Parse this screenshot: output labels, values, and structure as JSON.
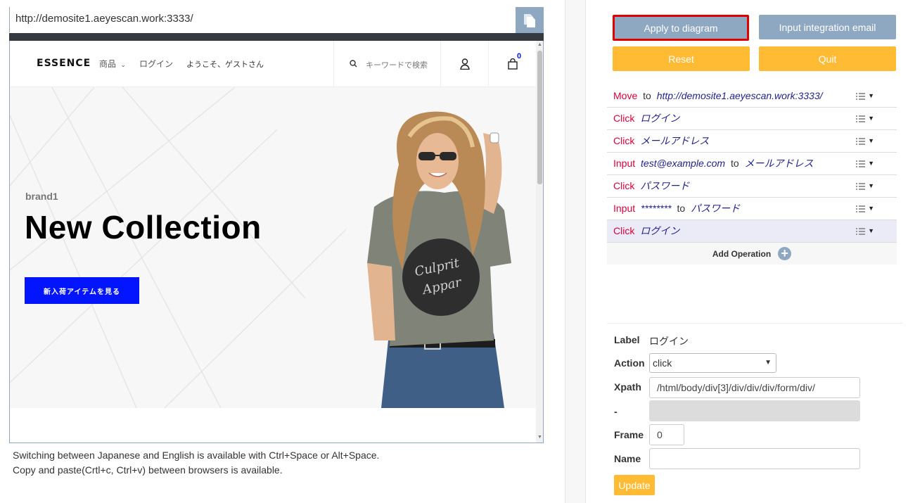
{
  "left_pane": {
    "url": "http://demosite1.aeyescan.work:3333/",
    "copy_icon": "copy-icon",
    "site": {
      "logo": "ESSENCE",
      "nav": {
        "products": "商品",
        "login": "ログイン",
        "welcome": "ようこそ、ゲストさん",
        "search_placeholder": "キーワードで検索",
        "cart_count": "0"
      },
      "hero": {
        "brand": "brand1",
        "title": "New Collection",
        "button": "新入荷アイテムを見る"
      }
    },
    "hints": [
      "Switching between Japanese and English is available with Ctrl+Space or Alt+Space.",
      "Copy and paste(Crtl+c, Ctrl+v) between browsers is available."
    ]
  },
  "right_pane": {
    "buttons": {
      "apply": "Apply to diagram",
      "input_email": "Input integration email",
      "reset": "Reset",
      "quit": "Quit"
    },
    "operations": [
      {
        "action": "Move",
        "target": "http://demosite1.aeyescan.work:3333/",
        "prefix": "",
        "prefix_target": ""
      },
      {
        "action": "Click",
        "target": "ログイン",
        "prefix": "",
        "prefix_target": ""
      },
      {
        "action": "Click",
        "target": "メールアドレス",
        "prefix": "",
        "prefix_target": ""
      },
      {
        "action": "Input",
        "target": "メールアドレス",
        "prefix": "",
        "prefix_target": "test@example.com"
      },
      {
        "action": "Click",
        "target": "パスワード",
        "prefix": "",
        "prefix_target": ""
      },
      {
        "action": "Input",
        "target": "パスワード",
        "prefix": "",
        "prefix_target": "********"
      },
      {
        "action": "Click",
        "target": "ログイン",
        "prefix": "",
        "prefix_target": ""
      }
    ],
    "to_word": "to",
    "add_operation": "Add Operation",
    "detail": {
      "label_title": "Label",
      "label_value": "ログイン",
      "action_title": "Action",
      "action_value": "click",
      "xpath_title": "Xpath",
      "xpath_value": "/html/body/div[3]/div/div/div/form/div/",
      "dash_title": "-",
      "frame_title": "Frame",
      "frame_value": "0",
      "name_title": "Name",
      "name_value": "",
      "update": "Update"
    }
  },
  "colors": {
    "accent_grey": "#8fa8c2",
    "accent_yellow": "#ffbb33",
    "action_red": "#d9003a",
    "target_navy": "#1f1f8c",
    "hero_blue": "#0315ff",
    "highlight_border": "#e00000"
  }
}
